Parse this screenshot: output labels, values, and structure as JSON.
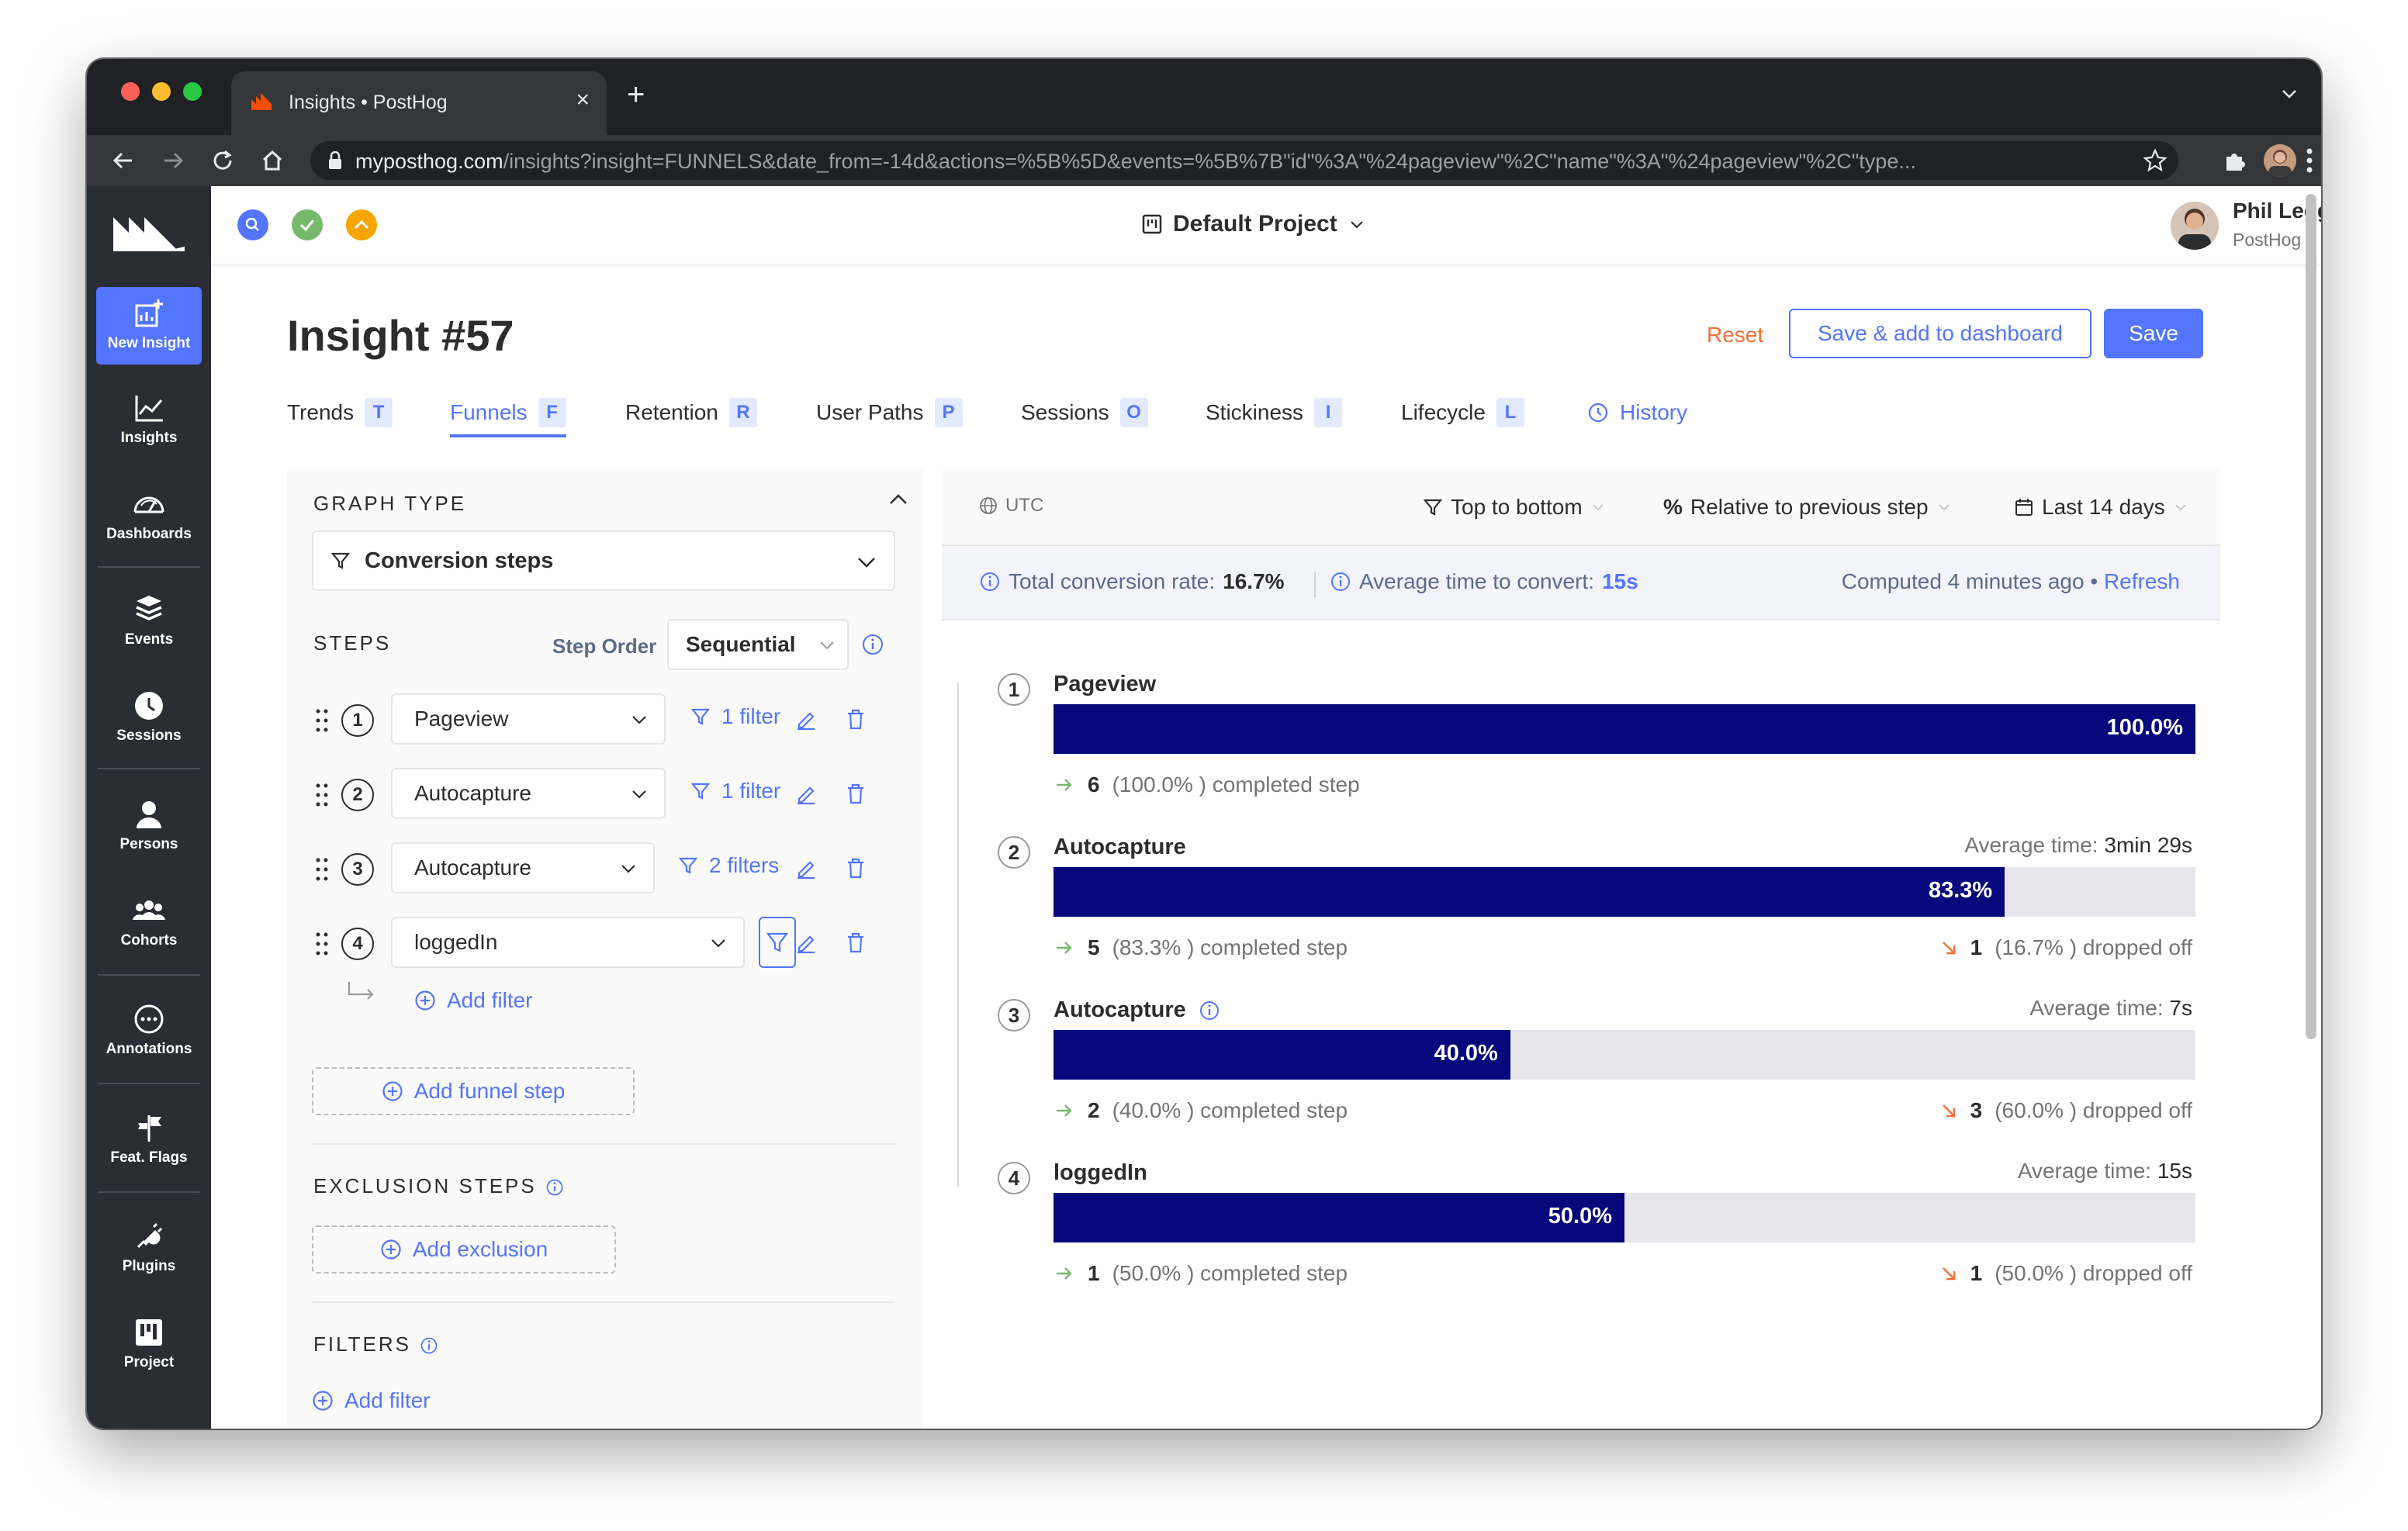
{
  "browser": {
    "tab_title": "Insights • PostHog",
    "url_host": "myposthog.com",
    "url_path": "/insights?insight=FUNNELS&date_from=-14d&actions=%5B%5D&events=%5B%7B\"id\"%3A\"%24pageview\"%2C\"name\"%3A\"%24pageview\"%2C\"type..."
  },
  "sidebar": {
    "items": [
      {
        "label": "New Insight",
        "icon": "new-insight-icon"
      },
      {
        "label": "Insights",
        "icon": "insights-chart-icon"
      },
      {
        "label": "Dashboards",
        "icon": "dashboards-gauge-icon"
      },
      {
        "label": "Events",
        "icon": "events-stack-icon"
      },
      {
        "label": "Sessions",
        "icon": "sessions-clock-icon"
      },
      {
        "label": "Persons",
        "icon": "person-icon"
      },
      {
        "label": "Cohorts",
        "icon": "cohorts-people-icon"
      },
      {
        "label": "Annotations",
        "icon": "annotations-chat-icon"
      },
      {
        "label": "Feat. Flags",
        "icon": "feature-flags-icon"
      },
      {
        "label": "Plugins",
        "icon": "plugins-plug-icon"
      },
      {
        "label": "Project",
        "icon": "project-board-icon"
      }
    ]
  },
  "topbar": {
    "project": "Default Project",
    "user_name": "Phil Leggetter",
    "user_org": "PostHog",
    "status_colors": [
      "#5375ff",
      "#77b96c",
      "#f7a501"
    ]
  },
  "page": {
    "title": "Insight #57",
    "reset": "Reset",
    "save_add": "Save & add to dashboard",
    "save": "Save"
  },
  "tabs": [
    {
      "label": "Trends",
      "key": "T"
    },
    {
      "label": "Funnels",
      "key": "F"
    },
    {
      "label": "Retention",
      "key": "R"
    },
    {
      "label": "User Paths",
      "key": "P"
    },
    {
      "label": "Sessions",
      "key": "O"
    },
    {
      "label": "Stickiness",
      "key": "I"
    },
    {
      "label": "Lifecycle",
      "key": "L"
    }
  ],
  "history_label": "History",
  "left": {
    "graph_type_title": "GRAPH TYPE",
    "graph_type_value": "Conversion steps",
    "steps_title": "STEPS",
    "step_order_label": "Step Order",
    "step_order_value": "Sequential",
    "steps": [
      {
        "num": "1",
        "event": "Pageview",
        "filter": "1 filter"
      },
      {
        "num": "2",
        "event": "Autocapture",
        "filter": "1 filter"
      },
      {
        "num": "3",
        "event": "Autocapture",
        "filter": "2 filters"
      },
      {
        "num": "4",
        "event": "loggedIn",
        "filter": ""
      }
    ],
    "add_filter": "Add filter",
    "add_funnel_step": "Add funnel step",
    "exclusion_title": "EXCLUSION STEPS",
    "add_exclusion": "Add exclusion",
    "filters_title": "FILTERS",
    "filters_add": "Add filter"
  },
  "right": {
    "timezone": "UTC",
    "layout": "Top to bottom",
    "conversion_mode": "Relative to previous step",
    "date_range": "Last 14 days",
    "total_conversion_label": "Total conversion rate:",
    "total_conversion_value": "16.7%",
    "avg_time_label": "Average time to convert:",
    "avg_time_value": "15s",
    "computed": "Computed 4 minutes ago",
    "refresh": "Refresh",
    "avg_time_prefix": "Average time:",
    "completed_suffix": ") completed step",
    "dropped_suffix": ") dropped off"
  },
  "funnel_steps": [
    {
      "num": "1",
      "name": "Pageview",
      "pct": 100.0,
      "pct_label": "100.0%",
      "avg_time": "",
      "completed_count": "6",
      "completed_pct": "(100.0%",
      "dropped_count": "",
      "dropped_pct": ""
    },
    {
      "num": "2",
      "name": "Autocapture",
      "pct": 83.3,
      "pct_label": "83.3%",
      "avg_time": "3min 29s",
      "completed_count": "5",
      "completed_pct": "(83.3%",
      "dropped_count": "1",
      "dropped_pct": "(16.7%"
    },
    {
      "num": "3",
      "name": "Autocapture",
      "pct": 40.0,
      "pct_label": "40.0%",
      "avg_time": "7s",
      "completed_count": "2",
      "completed_pct": "(40.0%",
      "dropped_count": "3",
      "dropped_pct": "(60.0%"
    },
    {
      "num": "4",
      "name": "loggedIn",
      "pct": 50.0,
      "pct_label": "50.0%",
      "avg_time": "15s",
      "completed_count": "1",
      "completed_pct": "(50.0%",
      "dropped_count": "1",
      "dropped_pct": "(50.0%"
    }
  ],
  "colors": {
    "accent": "#5375ff",
    "bar": "#07087c",
    "reset": "#f56e3a",
    "sidebar": "#2b2d35"
  }
}
